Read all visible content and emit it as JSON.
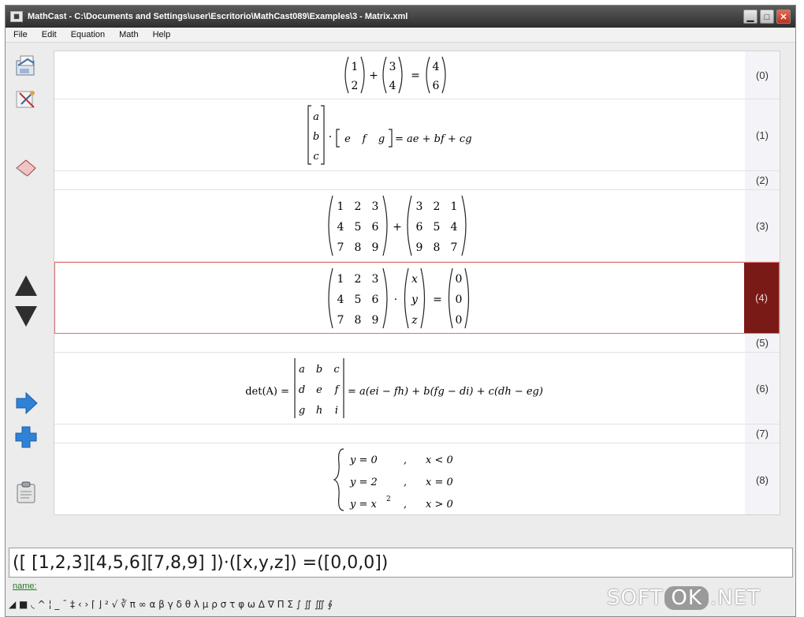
{
  "window": {
    "title": "MathCast - C:\\Documents and Settings\\user\\Escritorio\\MathCast089\\Examples\\3 - Matrix.xml",
    "app_icon": "mathcast-icon",
    "controls": {
      "minimize": "minimize-icon",
      "maximize": "maximize-icon",
      "close": "close-icon"
    }
  },
  "menu": [
    "File",
    "Edit",
    "Equation",
    "Math",
    "Help"
  ],
  "toolbar": {
    "icons": [
      "save-icon",
      "edit-tool-icon",
      "eraser-icon",
      "move-up-icon",
      "move-down-icon",
      "next-arrow-icon",
      "add-equation-icon",
      "clipboard-icon"
    ]
  },
  "equations": [
    {
      "number": "(0)",
      "id": "eq0"
    },
    {
      "number": "(1)",
      "id": "eq1"
    },
    {
      "number": "(2)",
      "id": "eq2"
    },
    {
      "number": "(3)",
      "id": "eq3"
    },
    {
      "number": "(4)",
      "id": "eq4"
    },
    {
      "number": "(5)",
      "id": "eq5"
    },
    {
      "number": "(6)",
      "id": "eq6"
    },
    {
      "number": "(7)",
      "id": "eq7"
    },
    {
      "number": "(8)",
      "id": "eq8"
    }
  ],
  "math": {
    "m0a": [
      "1",
      "2"
    ],
    "m0b": [
      "3",
      "4"
    ],
    "m0c": [
      "4",
      "6"
    ],
    "m1col": [
      "a",
      "b",
      "c"
    ],
    "m1row": [
      "e",
      "f",
      "g"
    ],
    "m1rhs": "= ae + bf + cg",
    "m3a": [
      [
        "1",
        "2",
        "3"
      ],
      [
        "4",
        "5",
        "6"
      ],
      [
        "7",
        "8",
        "9"
      ]
    ],
    "m3b": [
      [
        "3",
        "2",
        "1"
      ],
      [
        "6",
        "5",
        "4"
      ],
      [
        "9",
        "8",
        "7"
      ]
    ],
    "m4a": [
      [
        "1",
        "2",
        "3"
      ],
      [
        "4",
        "5",
        "6"
      ],
      [
        "7",
        "8",
        "9"
      ]
    ],
    "m4b": [
      "x",
      "y",
      "z"
    ],
    "m4c": [
      "0",
      "0",
      "0"
    ],
    "m6lhs": "det(A) =",
    "m6": [
      [
        "a",
        "b",
        "c"
      ],
      [
        "d",
        "e",
        "f"
      ],
      [
        "g",
        "h",
        "i"
      ]
    ],
    "m6rhs": "= a(ei − fh) + b(fg − di) + c(dh − eg)",
    "cases": [
      {
        "expr": "y = 0",
        "cond": "x < 0"
      },
      {
        "expr": "y = 2",
        "cond": "x = 0"
      },
      {
        "expr": "y = x",
        "sup": "2",
        "cond": "x > 0"
      }
    ],
    "ops": {
      "plus": "+",
      "eq": "=",
      "dot": "·",
      "comma": ","
    }
  },
  "editor": {
    "input": "([ [1,2,3][4,5,6][7,8,9] ])·([x,y,z]) =([0,0,0])",
    "name_label": "name:"
  },
  "palette": "◢ ■ ◟ ^ ¦ _ ¯ ‡   ‹ ›  ⌈ ⌋   ² √ ∛   π ∞   α β γ δ θ λ μ ρ σ τ φ ω   Δ ∇   Π Σ   ∫ ∬ ∭ ∮",
  "watermark": {
    "left": "SOFT",
    "mid": "OK",
    "right": ".NET"
  }
}
